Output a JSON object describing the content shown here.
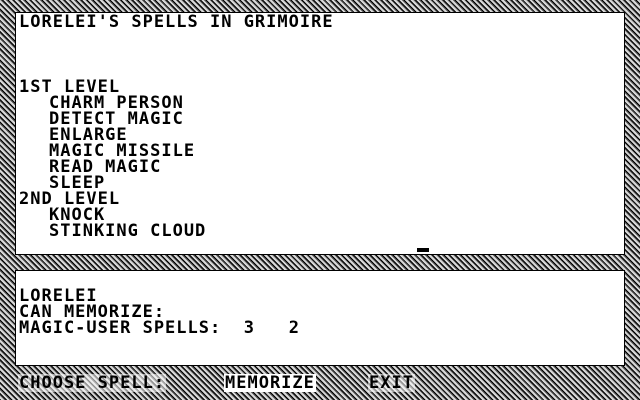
{
  "grimoire": {
    "title": "LORELEI'S SPELLS IN GRIMOIRE",
    "levels": [
      {
        "heading": "1ST LEVEL",
        "spells": [
          "CHARM PERSON",
          "DETECT MAGIC",
          "ENLARGE",
          "MAGIC MISSILE",
          "READ MAGIC",
          "SLEEP"
        ]
      },
      {
        "heading": "2ND LEVEL",
        "spells": [
          "KNOCK",
          "STINKING CLOUD"
        ]
      }
    ]
  },
  "status": {
    "character": "LORELEI",
    "can_memorize": "CAN MEMORIZE:",
    "class_label": "MAGIC-USER SPELLS:",
    "level1_count": "3",
    "level2_count": "2"
  },
  "menu": {
    "prompt": "CHOOSE SPELL:",
    "memorize": "MEMORIZE",
    "exit": "EXIT"
  }
}
